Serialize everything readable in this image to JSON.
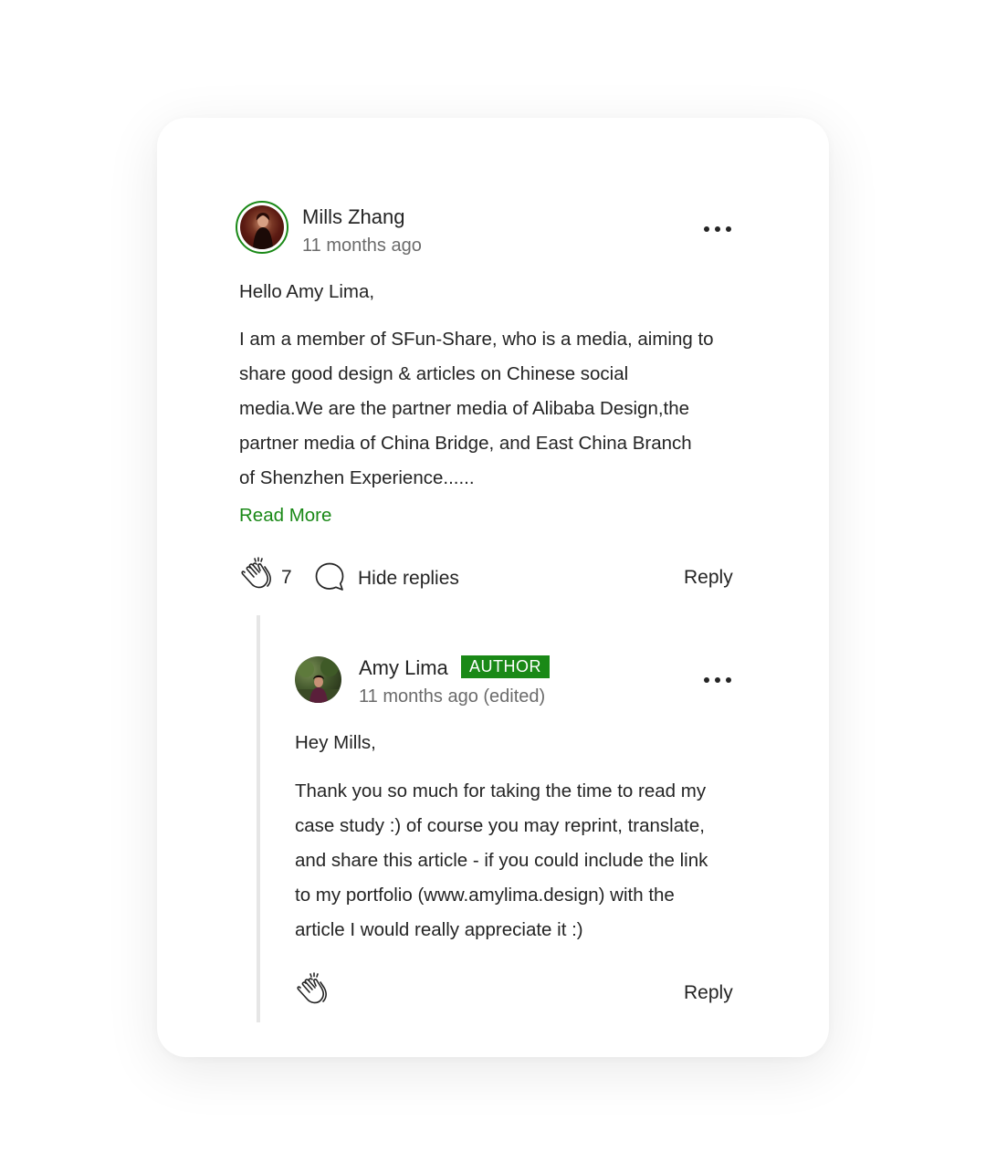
{
  "comment": {
    "author_name": "Mills Zhang",
    "timestamp": "11 months ago",
    "greeting": "Hello Amy Lima,",
    "body_lines": [
      "I am a member of SFun-Share, who is a media, aiming to",
      "share good design & articles on Chinese social",
      "media.We are the partner media of Alibaba Design,the",
      "partner media of China Bridge,   and East China Branch",
      "of Shenzhen Experience......"
    ],
    "read_more_label": "Read More",
    "clap_count": "7",
    "hide_replies_label": "Hide replies",
    "reply_label": "Reply"
  },
  "reply": {
    "author_name": "Amy Lima",
    "badge_label": "AUTHOR",
    "timestamp": "11 months ago (edited)",
    "greeting": "Hey Mills,",
    "body_lines": [
      "Thank you so much for taking the time to read my",
      "case study :) of course you may reprint, translate,",
      "and share this article - if you could include the link",
      "to my portfolio (www.amylima.design) with the",
      "article I would really appreciate it :)"
    ],
    "reply_label": "Reply"
  },
  "icons": {
    "more": "more-horizontal-icon",
    "clap": "clap-icon",
    "response": "speech-bubble-icon"
  },
  "colors": {
    "accent_green": "#1a8917",
    "text_primary": "#242424",
    "text_secondary": "#6b6b6b",
    "thread_line": "#e6e6e6"
  }
}
